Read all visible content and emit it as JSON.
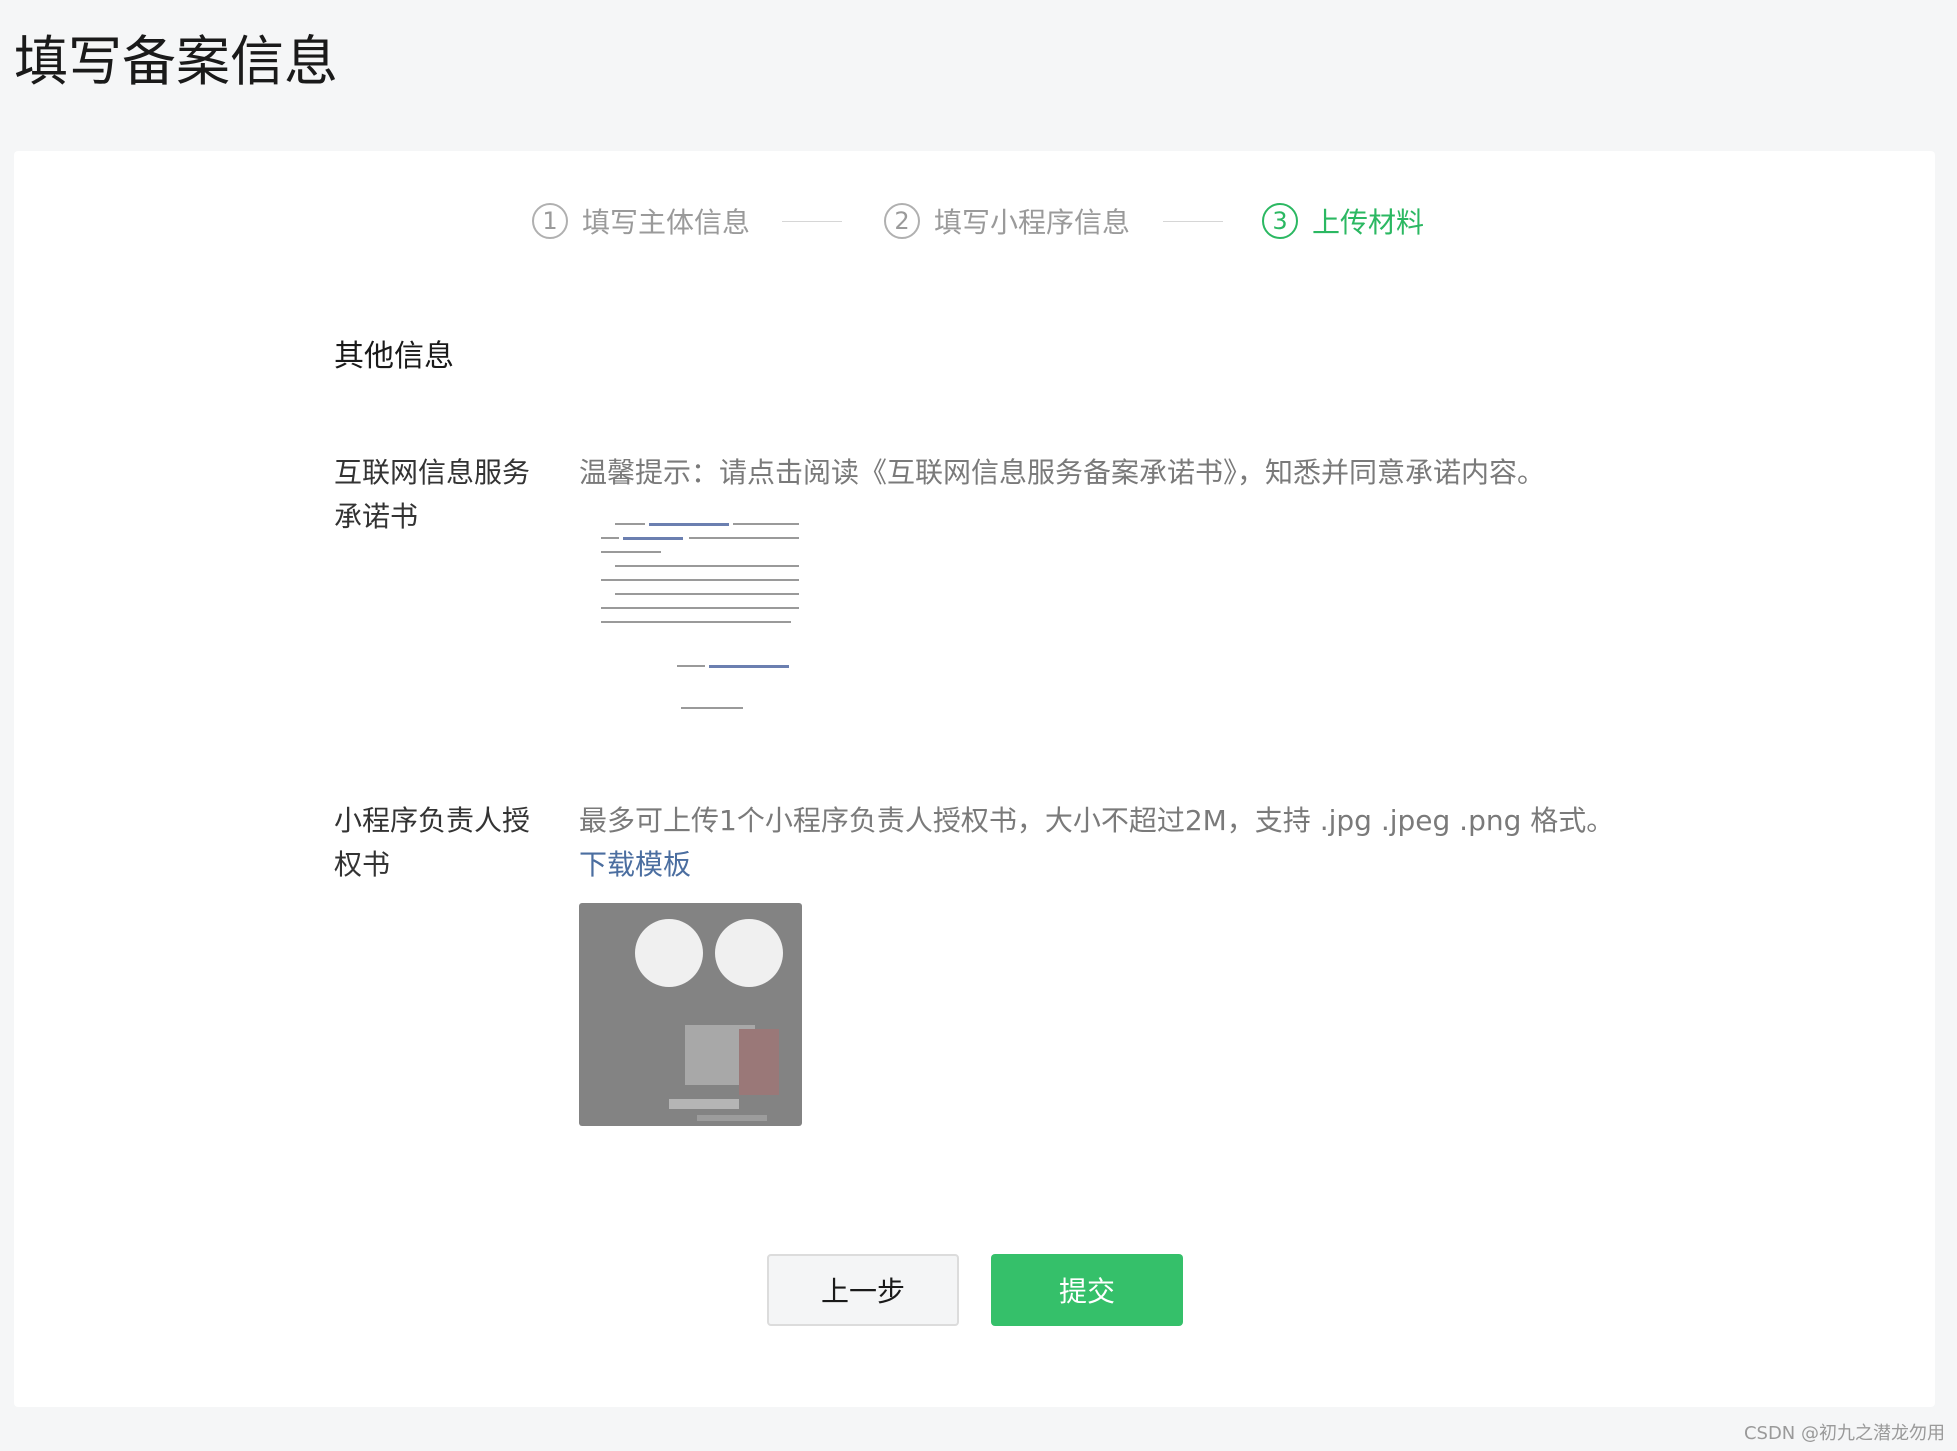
{
  "page": {
    "title": "填写备案信息"
  },
  "steps": [
    {
      "num": "1",
      "label": "填写主体信息",
      "active": false
    },
    {
      "num": "2",
      "label": "填写小程序信息",
      "active": false
    },
    {
      "num": "3",
      "label": "上传材料",
      "active": true
    }
  ],
  "section": {
    "title": "其他信息"
  },
  "fields": {
    "commitment": {
      "label": "互联网信息服务承诺书",
      "tip": "温馨提示：请点击阅读《互联网信息服务备案承诺书》，知悉并同意承诺内容。"
    },
    "authorization": {
      "label": "小程序负责人授权书",
      "tip": "最多可上传1个小程序负责人授权书，大小不超过2M，支持 .jpg .jpeg .png 格式。",
      "link": "下载模板"
    }
  },
  "buttons": {
    "prev": "上一步",
    "submit": "提交"
  },
  "colors": {
    "accent": "#2bb862",
    "submit_bg": "#35c06a",
    "link": "#4b6ea0"
  },
  "watermark": "CSDN @初九之潜龙勿用"
}
